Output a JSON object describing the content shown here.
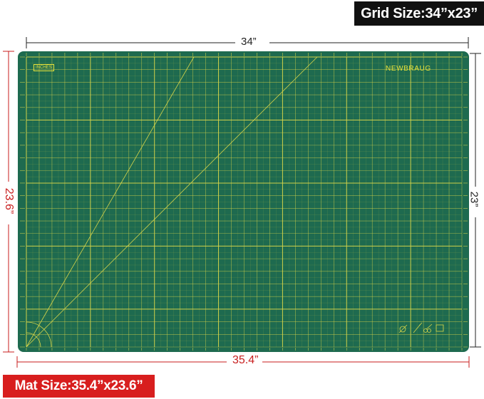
{
  "badges": {
    "grid_size": "Grid Size:34”x23”",
    "mat_size": "Mat Size:35.4”x23.6”"
  },
  "dimensions": {
    "grid_width": "34”",
    "grid_height": "23”",
    "mat_width": "35.4”",
    "mat_height": "23.6”"
  },
  "mat": {
    "brand": "NEWBRAUG",
    "unit_tag": "INCHES",
    "colors": {
      "mat_green": "#1e6a4f",
      "grid_yellow": "#d8d64a",
      "dim_red": "#c81e1e",
      "badge_black": "#111111",
      "badge_red": "#d81e1e"
    },
    "grid_columns": 34,
    "grid_rows": 23
  }
}
